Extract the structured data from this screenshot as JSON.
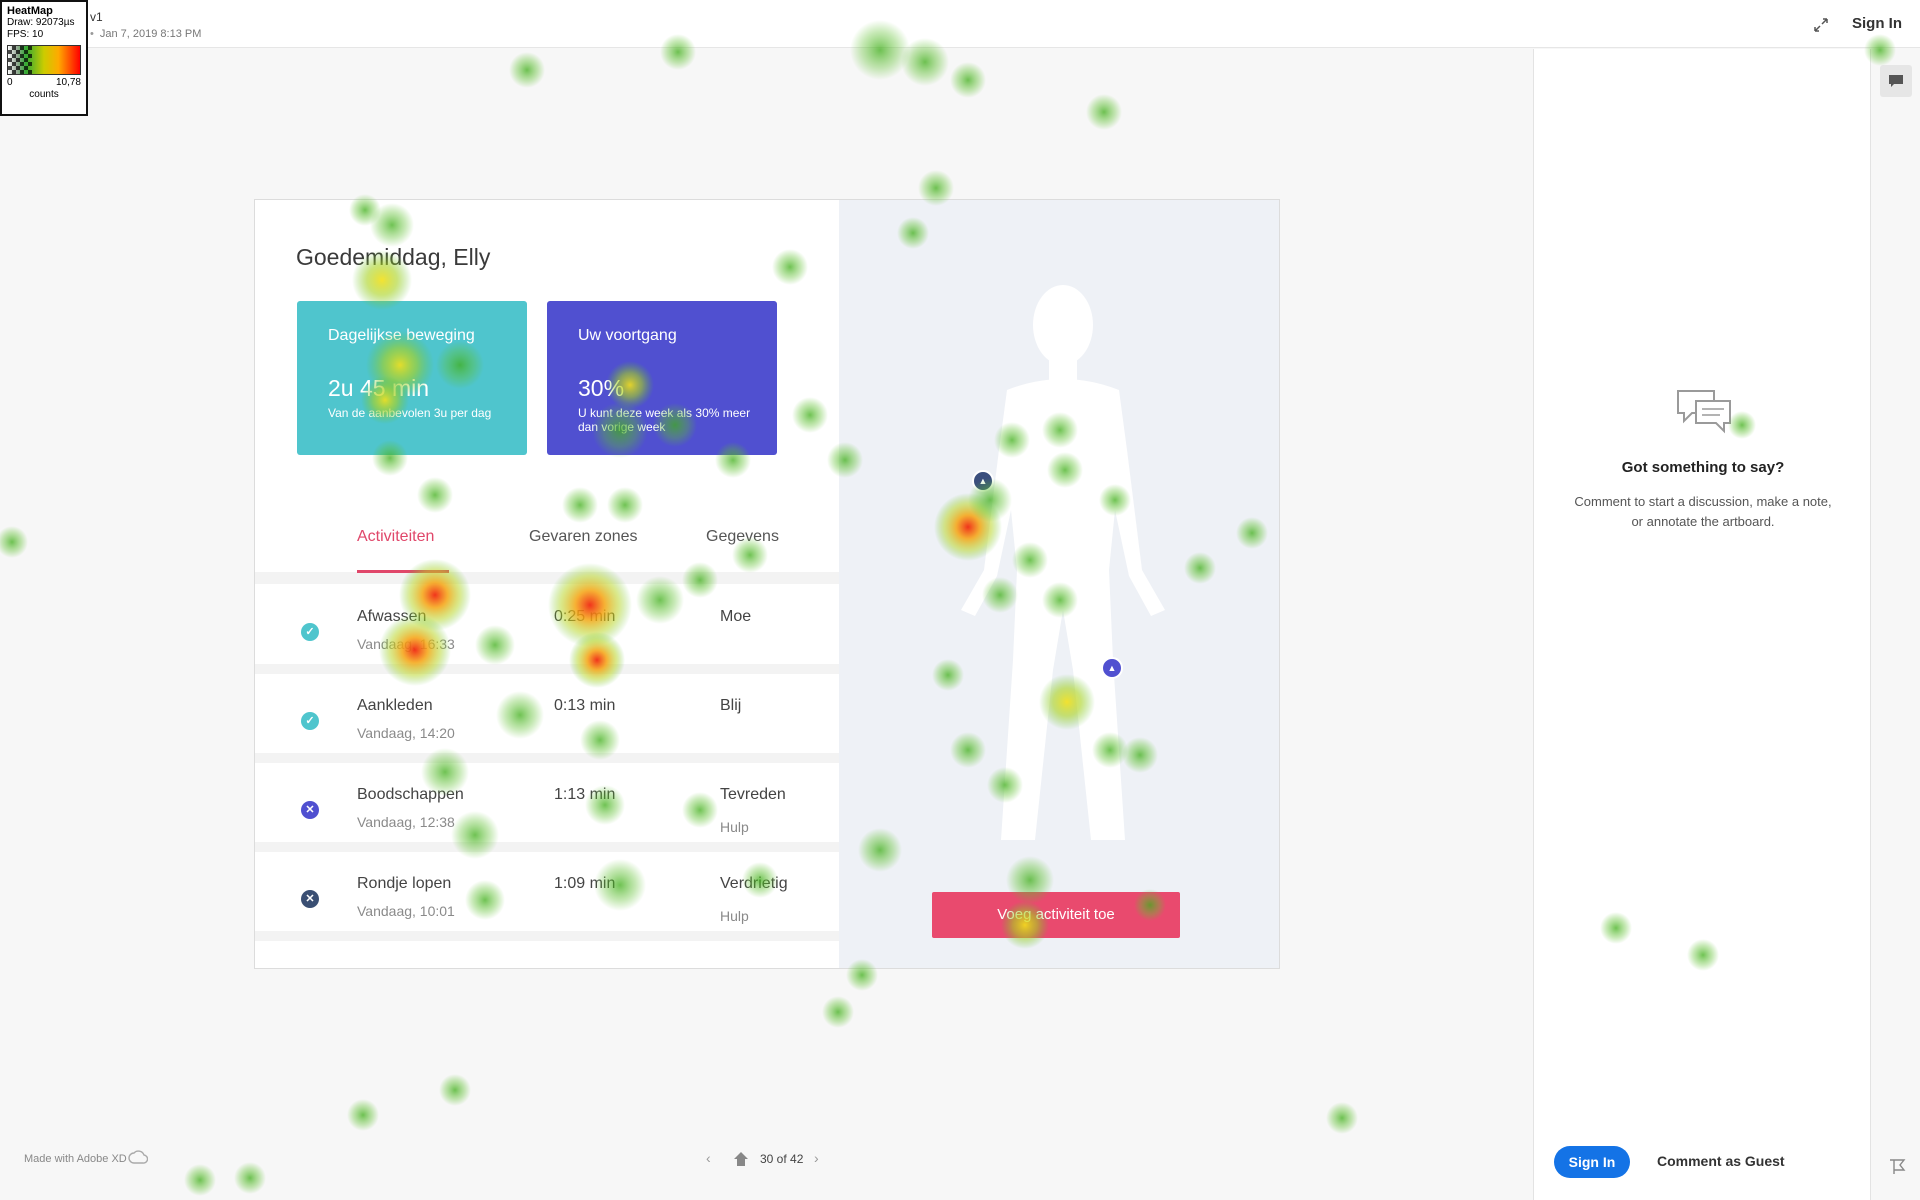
{
  "heatmap_legend": {
    "title": "HeatMap",
    "draw": "Draw: 92073µs",
    "fps": "FPS: 10",
    "min": "0",
    "max": "10,78",
    "unit": "counts"
  },
  "topbar": {
    "version": "v1",
    "date": "Jan 7, 2019 8:13 PM",
    "signin_label": "Sign In"
  },
  "artboard": {
    "greeting": "Goedemiddag, Elly",
    "cards": [
      {
        "title": "Dagelijkse beweging",
        "value": "2u 45 min",
        "description": "Van de aanbevolen 3u per dag",
        "color": "#4fc5cd"
      },
      {
        "title": "Uw voortgang",
        "value": "30%",
        "description": "U kunt deze week als 30% meer dan vorige week",
        "color": "#5050d0"
      }
    ],
    "tabs": [
      "Activiteiten",
      "Gevaren zones",
      "Gegevens"
    ],
    "activities": [
      {
        "name": "Afwassen",
        "time": "Vandaag, 16:33",
        "duration": "0:25 min",
        "mood": "Moe",
        "sub": "",
        "status": "done"
      },
      {
        "name": "Aankleden",
        "time": "Vandaag, 14:20",
        "duration": "0:13 min",
        "mood": "Blij",
        "sub": "",
        "status": "done"
      },
      {
        "name": "Boodschappen",
        "time": "Vandaag, 12:38",
        "duration": "1:13 min",
        "mood": "Tevreden",
        "sub": "Hulp",
        "status": "failed"
      },
      {
        "name": "Rondje lopen",
        "time": "Vandaag, 10:01",
        "duration": "1:09 min",
        "mood": "Verdrietig",
        "sub": "Hulp",
        "status": "failed"
      }
    ],
    "add_button_label": "Voeg activiteit toe",
    "accent_color": "#e94a6e"
  },
  "comments": {
    "heading": "Got something to say?",
    "text": "Comment to start a discussion, make a note, or annotate the artboard.",
    "signin_label": "Sign In",
    "guest_label": "Comment as Guest"
  },
  "footer": {
    "made_with": "Made with Adobe XD",
    "page_count": "30 of 42"
  },
  "icons": [
    "expand-icon",
    "comment-icon",
    "flag-icon",
    "creative-cloud-icon",
    "home-icon",
    "chevron-left-icon",
    "chevron-right-icon",
    "check-icon",
    "close-icon",
    "warning-marker-icon",
    "speech-bubbles-icon"
  ]
}
